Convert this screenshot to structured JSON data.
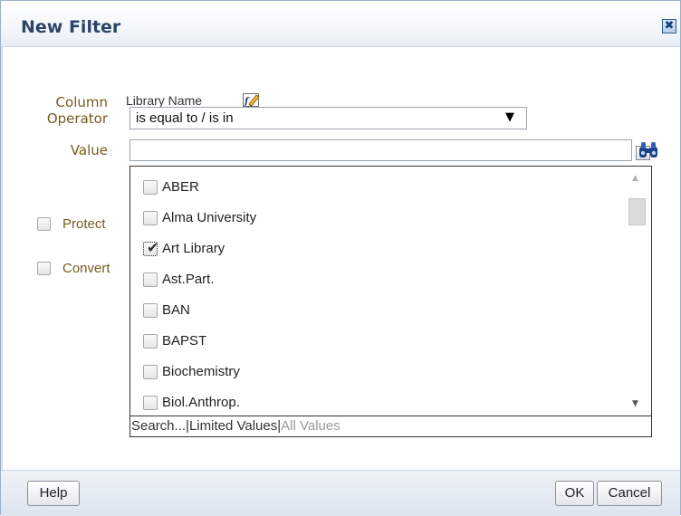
{
  "dialog": {
    "title": "New Filter",
    "close_glyph": "✖"
  },
  "form": {
    "column_label": "Column",
    "column_value": "Library Name",
    "operator_label": "Operator",
    "operator_value": "is equal to / is in",
    "value_label": "Value",
    "value_input": "",
    "protect_label": "Protect",
    "convert_label": "Convert"
  },
  "value_list": {
    "items": [
      {
        "label": "ABER",
        "checked": false
      },
      {
        "label": "Alma University",
        "checked": false
      },
      {
        "label": "Art Library",
        "checked": true
      },
      {
        "label": "Ast.Part.",
        "checked": false
      },
      {
        "label": "BAN",
        "checked": false
      },
      {
        "label": "BAPST",
        "checked": false
      },
      {
        "label": "Biochemistry",
        "checked": false
      },
      {
        "label": "Biol.Anthrop.",
        "checked": false
      }
    ],
    "search_link": "Search...",
    "limited_link": "Limited Values",
    "all_link": "All Values",
    "separator": "|"
  },
  "footer": {
    "help_label": "Help",
    "ok_label": "OK",
    "cancel_label": "Cancel"
  },
  "icons": {
    "close": "close-icon",
    "edit_formula": "edit-formula-icon",
    "dropdown": "chevron-down-icon",
    "search": "binoculars-icon"
  },
  "colors": {
    "label": "#7a5a1d",
    "title": "#2c4566",
    "border": "#9ab0c8"
  }
}
